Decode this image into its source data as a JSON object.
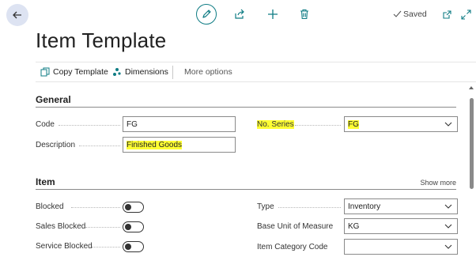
{
  "header": {
    "title": "Item Template",
    "saved_label": "Saved",
    "icons": [
      "back-arrow-icon",
      "pencil-icon",
      "share-icon",
      "plus-icon",
      "trash-icon",
      "check-icon",
      "open-in-new-icon",
      "expand-icon"
    ]
  },
  "actions": {
    "copy_template": "Copy Template",
    "dimensions": "Dimensions",
    "more_options": "More options"
  },
  "general": {
    "heading": "General",
    "code_label": "Code",
    "code_value": "FG",
    "description_label": "Description",
    "description_value": "Finished Goods",
    "no_series_label": "No. Series",
    "no_series_value": "FG"
  },
  "item": {
    "heading": "Item",
    "show_more": "Show more",
    "blocked_label": "Blocked",
    "blocked_value": false,
    "sales_blocked_label": "Sales Blocked",
    "sales_blocked_value": false,
    "service_blocked_label": "Service Blocked",
    "service_blocked_value": false,
    "type_label": "Type",
    "type_value": "Inventory",
    "base_uom_label": "Base Unit of Measure",
    "base_uom_value": "KG",
    "item_category_label": "Item Category Code",
    "item_category_value": ""
  },
  "colors": {
    "accent": "#0f7c84",
    "highlight": "#ffff33",
    "back_button_bg": "#dde3f2"
  }
}
